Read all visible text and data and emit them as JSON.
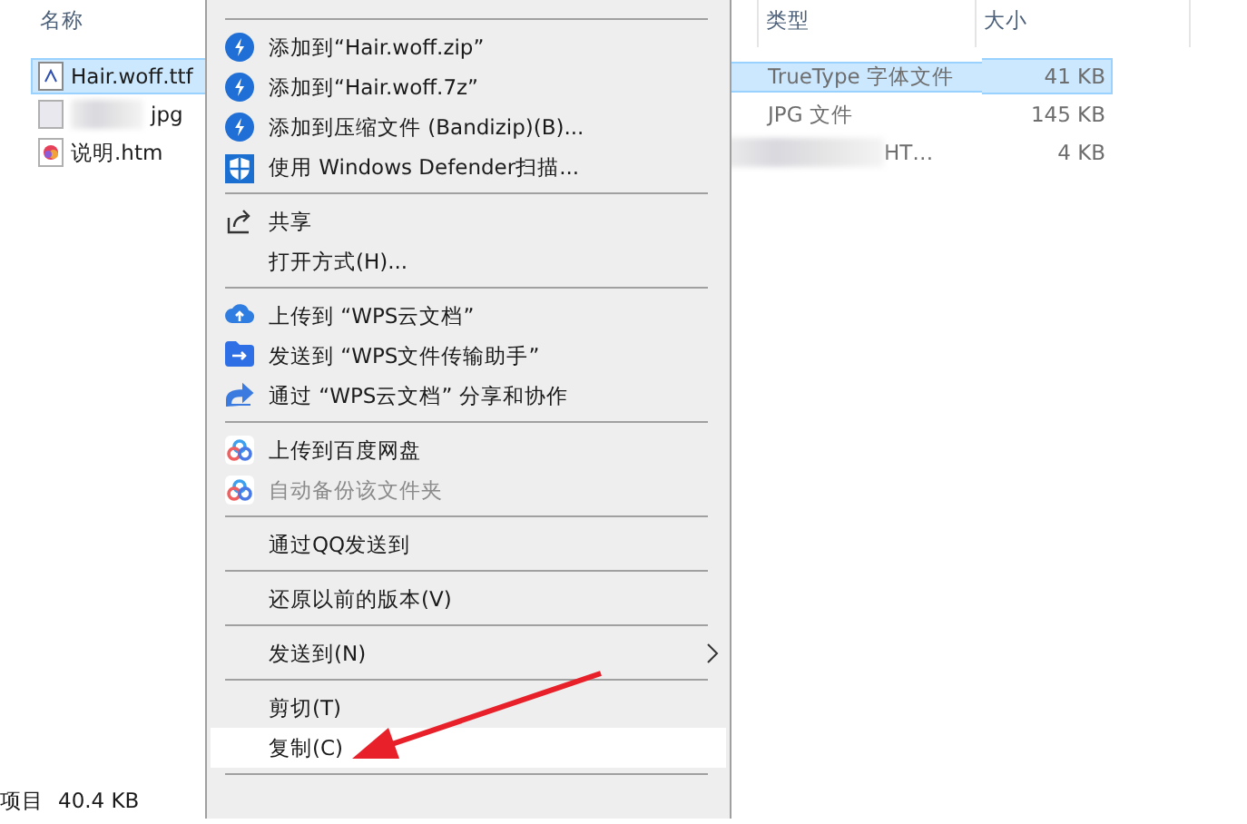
{
  "columns": [
    "名称",
    "类型",
    "大小"
  ],
  "files": [
    {
      "name": "Hair.woff.ttf",
      "kind": "font",
      "type": "TrueType 字体文件",
      "size": "41 KB",
      "selected": true
    },
    {
      "name": "jpg",
      "kind": "image",
      "type": "JPG 文件",
      "size": "145 KB",
      "selected": false
    },
    {
      "name": "说明.htm",
      "kind": "web",
      "type": "HT…",
      "size": "4 KB",
      "selected": false
    }
  ],
  "status_bar": {
    "count": "项目",
    "size": "40.4 KB"
  },
  "context_menu": [
    {
      "kind": "separator"
    },
    {
      "kind": "lightning",
      "label": "添加到“Hair.woff.zip”",
      "disabled": false,
      "selected": false
    },
    {
      "kind": "lightning",
      "label": "添加到“Hair.woff.7z”",
      "disabled": false,
      "selected": false
    },
    {
      "kind": "lightning",
      "label": "添加到压缩文件 (Bandizip)(B)...",
      "disabled": false,
      "selected": false
    },
    {
      "kind": "shield",
      "label": "使用 Windows Defender扫描...",
      "disabled": false,
      "selected": false
    },
    {
      "kind": "separator"
    },
    {
      "kind": "share",
      "label": "共享",
      "disabled": false,
      "selected": false
    },
    {
      "kind": "plain",
      "label": "打开方式(H)...",
      "disabled": false,
      "selected": false
    },
    {
      "kind": "separator"
    },
    {
      "kind": "cloud",
      "label": "上传到 “WPS云文档”",
      "disabled": false,
      "selected": false
    },
    {
      "kind": "folder",
      "label": "发送到 “WPS文件传输助手”",
      "disabled": false,
      "selected": false
    },
    {
      "kind": "forward",
      "label": "通过 “WPS云文档” 分享和协作",
      "disabled": false,
      "selected": false
    },
    {
      "kind": "separator"
    },
    {
      "kind": "rings",
      "label": "上传到百度网盘",
      "disabled": false,
      "selected": false
    },
    {
      "kind": "rings",
      "label": "自动备份该文件夹",
      "disabled": true,
      "selected": false
    },
    {
      "kind": "separator"
    },
    {
      "kind": "plain",
      "label": "通过QQ发送到",
      "disabled": false,
      "selected": false
    },
    {
      "kind": "separator"
    },
    {
      "kind": "plain",
      "label": "还原以前的版本(V)",
      "disabled": false,
      "selected": false
    },
    {
      "kind": "separator"
    },
    {
      "kind": "submenu",
      "label": "发送到(N)",
      "disabled": false,
      "selected": false
    },
    {
      "kind": "separator"
    },
    {
      "kind": "plain",
      "label": "剪切(T)",
      "disabled": false,
      "selected": false
    },
    {
      "kind": "plain",
      "label": "复制(C)",
      "disabled": false,
      "selected": true
    },
    {
      "kind": "separator"
    }
  ]
}
